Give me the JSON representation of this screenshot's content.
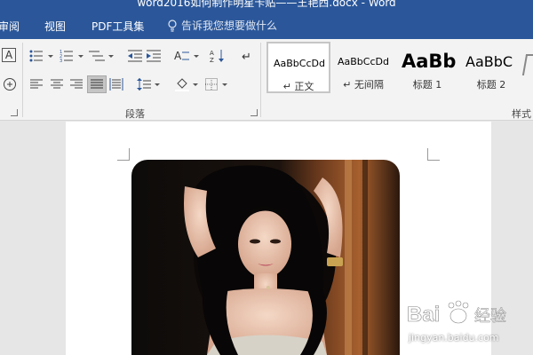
{
  "window": {
    "title": "word2016如何制作明星卡贴——王艳西.docx - Word"
  },
  "menu": {
    "tabs": [
      "审阅",
      "视图",
      "PDF工具集"
    ],
    "tell_me": "告诉我您想要做什么"
  },
  "ribbon": {
    "paragraph_group_label": "段落",
    "styles_group_label": "样式",
    "styles": [
      {
        "sample": "AaBbCcDd",
        "name": "正文",
        "selected": true
      },
      {
        "sample": "AaBbCcDd",
        "name": "无间隔",
        "selected": false
      },
      {
        "sample": "AaBb",
        "name": "标题 1",
        "selected": false
      },
      {
        "sample": "AaBbC",
        "name": "标题 2",
        "selected": false
      }
    ]
  },
  "colors": {
    "titlebar": "#2b579a",
    "ribbon_bg": "#f3f3f3",
    "doc_bg": "#e6e6e6",
    "page_bg": "#ffffff"
  },
  "watermark": {
    "logo": "Baidu经验",
    "url": "jingyan.baidu.com"
  }
}
